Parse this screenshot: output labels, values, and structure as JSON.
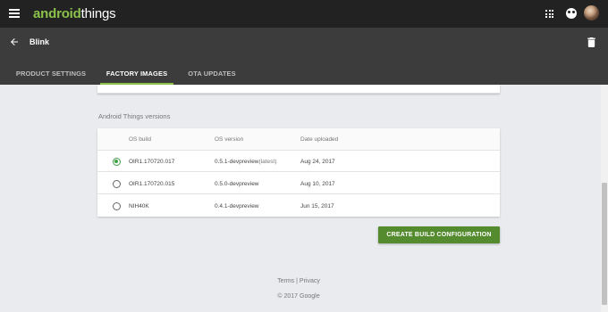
{
  "brand": {
    "part1": "android",
    "part2": "things",
    "accent": "#8bc34a"
  },
  "header": {
    "project_title": "Blink"
  },
  "tabs": [
    {
      "label": "PRODUCT SETTINGS",
      "active": false
    },
    {
      "label": "FACTORY IMAGES",
      "active": true
    },
    {
      "label": "OTA UPDATES",
      "active": false
    }
  ],
  "section": {
    "title": "Android Things versions"
  },
  "table": {
    "headers": [
      "OS build",
      "OS version",
      "Date uploaded"
    ],
    "rows": [
      {
        "build": "OIR1.170720.017",
        "version": "0.5.1-devpreview",
        "tag": "(latest)",
        "date": "Aug 24, 2017",
        "selected": true
      },
      {
        "build": "OIR1.170720.015",
        "version": "0.5.0-devpreview",
        "tag": "",
        "date": "Aug 10, 2017",
        "selected": false
      },
      {
        "build": "NIH40K",
        "version": "0.4.1-devpreview",
        "tag": "",
        "date": "Jun 15, 2017",
        "selected": false
      }
    ]
  },
  "actions": {
    "create_label": "CREATE BUILD CONFIGURATION",
    "button_color": "#558b2f"
  },
  "footer": {
    "terms": "Terms",
    "separator": "|",
    "privacy": "Privacy",
    "copyright": "© 2017 Google"
  },
  "icons": [
    "menu-icon",
    "apps-icon",
    "account-icon",
    "back-arrow-icon",
    "delete-icon",
    "radio-selected-icon",
    "radio-unselected-icon"
  ]
}
